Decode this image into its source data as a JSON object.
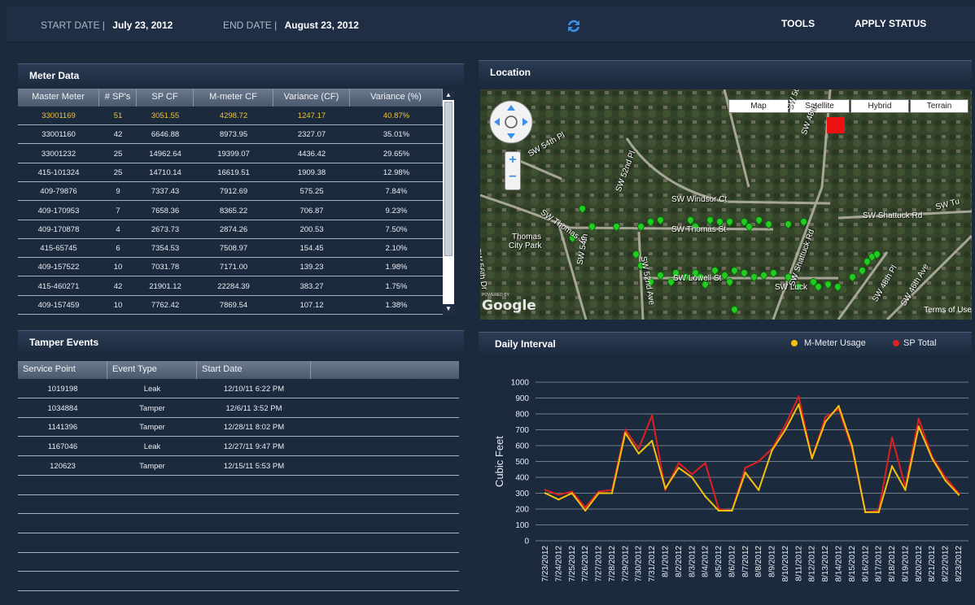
{
  "header": {
    "start_label": "START DATE |",
    "start_value": "July 23, 2012",
    "end_label": "END DATE |",
    "end_value": "August 23, 2012",
    "tools": "TOOLS",
    "apply_status": "APPLY STATUS"
  },
  "meter": {
    "title": "Meter Data",
    "columns": [
      "Master Meter",
      "# SP's",
      "SP CF",
      "M-meter CF",
      "Variance (CF)",
      "Variance (%)"
    ],
    "rows": [
      [
        "33001169",
        "51",
        "3051.55",
        "4298.72",
        "1247.17",
        "40.87%"
      ],
      [
        "33001160",
        "42",
        "6646.88",
        "8973.95",
        "2327.07",
        "35.01%"
      ],
      [
        "33001232",
        "25",
        "14962.64",
        "19399.07",
        "4436.42",
        "29.65%"
      ],
      [
        "415-101324",
        "25",
        "14710.14",
        "16619.51",
        "1909.38",
        "12.98%"
      ],
      [
        "409-79876",
        "9",
        "7337.43",
        "7912.69",
        "575.25",
        "7.84%"
      ],
      [
        "409-170953",
        "7",
        "7658.36",
        "8365.22",
        "706.87",
        "9.23%"
      ],
      [
        "409-170878",
        "4",
        "2673.73",
        "2874.26",
        "200.53",
        "7.50%"
      ],
      [
        "415-65745",
        "6",
        "7354.53",
        "7508.97",
        "154.45",
        "2.10%"
      ],
      [
        "409-157522",
        "10",
        "7031.78",
        "7171.00",
        "139.23",
        "1.98%"
      ],
      [
        "415-460271",
        "42",
        "21901.12",
        "22284.39",
        "383.27",
        "1.75%"
      ],
      [
        "409-157459",
        "10",
        "7762.42",
        "7869.54",
        "107.12",
        "1.38%"
      ]
    ]
  },
  "tamper": {
    "title": "Tamper Events",
    "columns": [
      "Service Point",
      "Event Type",
      "Start Date"
    ],
    "rows": [
      [
        "1019198",
        "Leak",
        "12/10/11 6:22 PM"
      ],
      [
        "1034884",
        "Tamper",
        "12/6/11 3:52 PM"
      ],
      [
        "1141396",
        "Tamper",
        "12/28/11 8:02 PM"
      ],
      [
        "1167046",
        "Leak",
        "12/27/11 9:47 PM"
      ],
      [
        "120623",
        "Tamper",
        "12/15/11 5:53 PM"
      ]
    ]
  },
  "location": {
    "title": "Location",
    "map_types": [
      "Map",
      "Satellite",
      "Hybrid",
      "Terrain"
    ],
    "street_labels": [
      "SW 54th Pl",
      "SW 52nd Pl",
      "SW 50th",
      "SW 48th",
      "SW Windsor Ct",
      "SW Shattuck Rd",
      "SW Thomas St",
      "SW Thomas St",
      "SW Lowell St",
      "SW 52nd Ave",
      "SW Shattuck Rd",
      "SW Luck",
      "SW 48th Pl",
      "SW 46th Ave",
      "SW 56th Dr",
      "SW 54th",
      "SW Tu"
    ],
    "park": [
      "Thomas",
      "City Park"
    ],
    "powered": "POWERED BY",
    "google": "Google",
    "terms": "Terms of Use"
  },
  "daily": {
    "title": "Daily Interval",
    "legend": [
      "M-Meter Usage",
      "SP Total"
    ]
  },
  "colors": {
    "mmeter": "#f4c20d",
    "sptotal": "#e02020",
    "highlight_row": "#f0c233",
    "marker": "#22cc22"
  },
  "chart_data": {
    "type": "line",
    "ylabel": "Cubic Feet",
    "xlabel": "",
    "ylim": [
      0,
      1000
    ],
    "yticks": [
      "0",
      "100",
      "200",
      "300",
      "400",
      "500",
      "600",
      "700",
      "800",
      "900",
      "1000"
    ],
    "categories": [
      "7/23/2012",
      "7/24/2012",
      "7/25/2012",
      "7/26/2012",
      "7/27/2012",
      "7/28/2012",
      "7/29/2012",
      "7/30/2012",
      "7/31/2012",
      "8/1/2012",
      "8/2/2012",
      "8/3/2012",
      "8/4/2012",
      "8/5/2012",
      "8/6/2012",
      "8/7/2012",
      "8/8/2012",
      "8/9/2012",
      "8/10/2012",
      "8/11/2012",
      "8/12/2012",
      "8/13/2012",
      "8/14/2012",
      "8/15/2012",
      "8/16/2012",
      "8/17/2012",
      "8/18/2012",
      "8/19/2012",
      "8/20/2012",
      "8/21/2012",
      "8/22/2012",
      "8/23/2012"
    ],
    "series": [
      {
        "name": "M-Meter Usage",
        "values": [
          300,
          260,
          300,
          190,
          300,
          300,
          680,
          550,
          630,
          330,
          460,
          400,
          280,
          190,
          190,
          430,
          320,
          570,
          700,
          860,
          520,
          750,
          850,
          600,
          180,
          180,
          470,
          320,
          720,
          520,
          380,
          290
        ]
      },
      {
        "name": "SP Total",
        "values": [
          320,
          290,
          310,
          210,
          310,
          320,
          700,
          580,
          790,
          320,
          490,
          420,
          490,
          200,
          190,
          460,
          500,
          580,
          730,
          910,
          520,
          780,
          830,
          580,
          180,
          190,
          650,
          340,
          770,
          530,
          400,
          300
        ]
      }
    ]
  },
  "map_markers": [
    [
      0.2,
      0.5
    ],
    [
      0.22,
      0.58
    ],
    [
      0.18,
      0.63
    ],
    [
      0.27,
      0.58
    ],
    [
      0.32,
      0.58
    ],
    [
      0.34,
      0.56
    ],
    [
      0.36,
      0.55
    ],
    [
      0.42,
      0.55
    ],
    [
      0.43,
      0.58
    ],
    [
      0.46,
      0.55
    ],
    [
      0.48,
      0.56
    ],
    [
      0.5,
      0.56
    ],
    [
      0.53,
      0.56
    ],
    [
      0.54,
      0.58
    ],
    [
      0.56,
      0.55
    ],
    [
      0.58,
      0.57
    ],
    [
      0.62,
      0.57
    ],
    [
      0.65,
      0.56
    ],
    [
      0.31,
      0.7
    ],
    [
      0.32,
      0.75
    ],
    [
      0.34,
      0.82
    ],
    [
      0.36,
      0.79
    ],
    [
      0.38,
      0.82
    ],
    [
      0.39,
      0.78
    ],
    [
      0.41,
      0.8
    ],
    [
      0.43,
      0.78
    ],
    [
      0.44,
      0.8
    ],
    [
      0.45,
      0.83
    ],
    [
      0.47,
      0.77
    ],
    [
      0.49,
      0.79
    ],
    [
      0.5,
      0.82
    ],
    [
      0.51,
      0.77
    ],
    [
      0.53,
      0.78
    ],
    [
      0.55,
      0.8
    ],
    [
      0.57,
      0.79
    ],
    [
      0.59,
      0.78
    ],
    [
      0.62,
      0.8
    ],
    [
      0.64,
      0.84
    ],
    [
      0.67,
      0.82
    ],
    [
      0.68,
      0.84
    ],
    [
      0.7,
      0.83
    ],
    [
      0.72,
      0.84
    ],
    [
      0.75,
      0.8
    ],
    [
      0.77,
      0.77
    ],
    [
      0.78,
      0.73
    ],
    [
      0.79,
      0.71
    ],
    [
      0.8,
      0.7
    ],
    [
      0.51,
      0.94
    ]
  ]
}
